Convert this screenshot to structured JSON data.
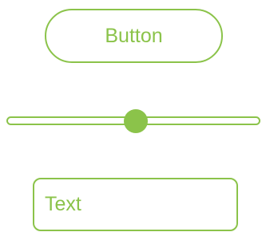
{
  "button": {
    "label": "Button"
  },
  "slider": {
    "value": 0.51
  },
  "text_field": {
    "value": "Text"
  },
  "colors": {
    "accent": "#8bc34a",
    "background": "#ffffff"
  }
}
